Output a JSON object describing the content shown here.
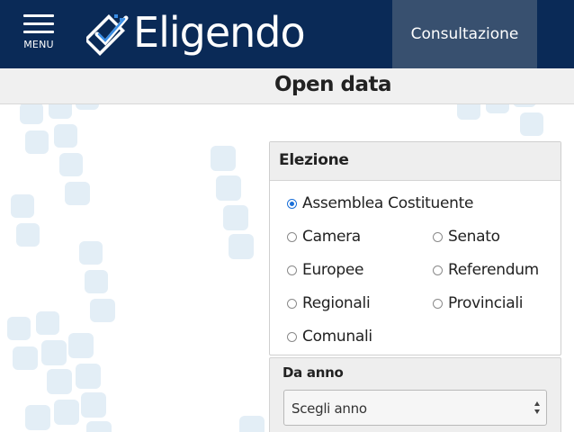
{
  "header": {
    "menu_label": "MENU",
    "brand": "Eligendo",
    "nav_item": "Consultazione"
  },
  "page": {
    "title": "Open data"
  },
  "election": {
    "heading": "Elezione",
    "options": [
      {
        "label": "Assemblea Costituente",
        "selected": true
      },
      {
        "label": "Camera",
        "selected": false
      },
      {
        "label": "Senato",
        "selected": false
      },
      {
        "label": "Europee",
        "selected": false
      },
      {
        "label": "Referendum",
        "selected": false
      },
      {
        "label": "Regionali",
        "selected": false
      },
      {
        "label": "Provinciali",
        "selected": false
      },
      {
        "label": "Comunali",
        "selected": false
      }
    ]
  },
  "year": {
    "label": "Da anno",
    "selected": "Scegli anno"
  },
  "colors": {
    "header_bg": "#0a2a57",
    "nav_active_bg": "#38506f",
    "accent": "#1a6fd8"
  }
}
